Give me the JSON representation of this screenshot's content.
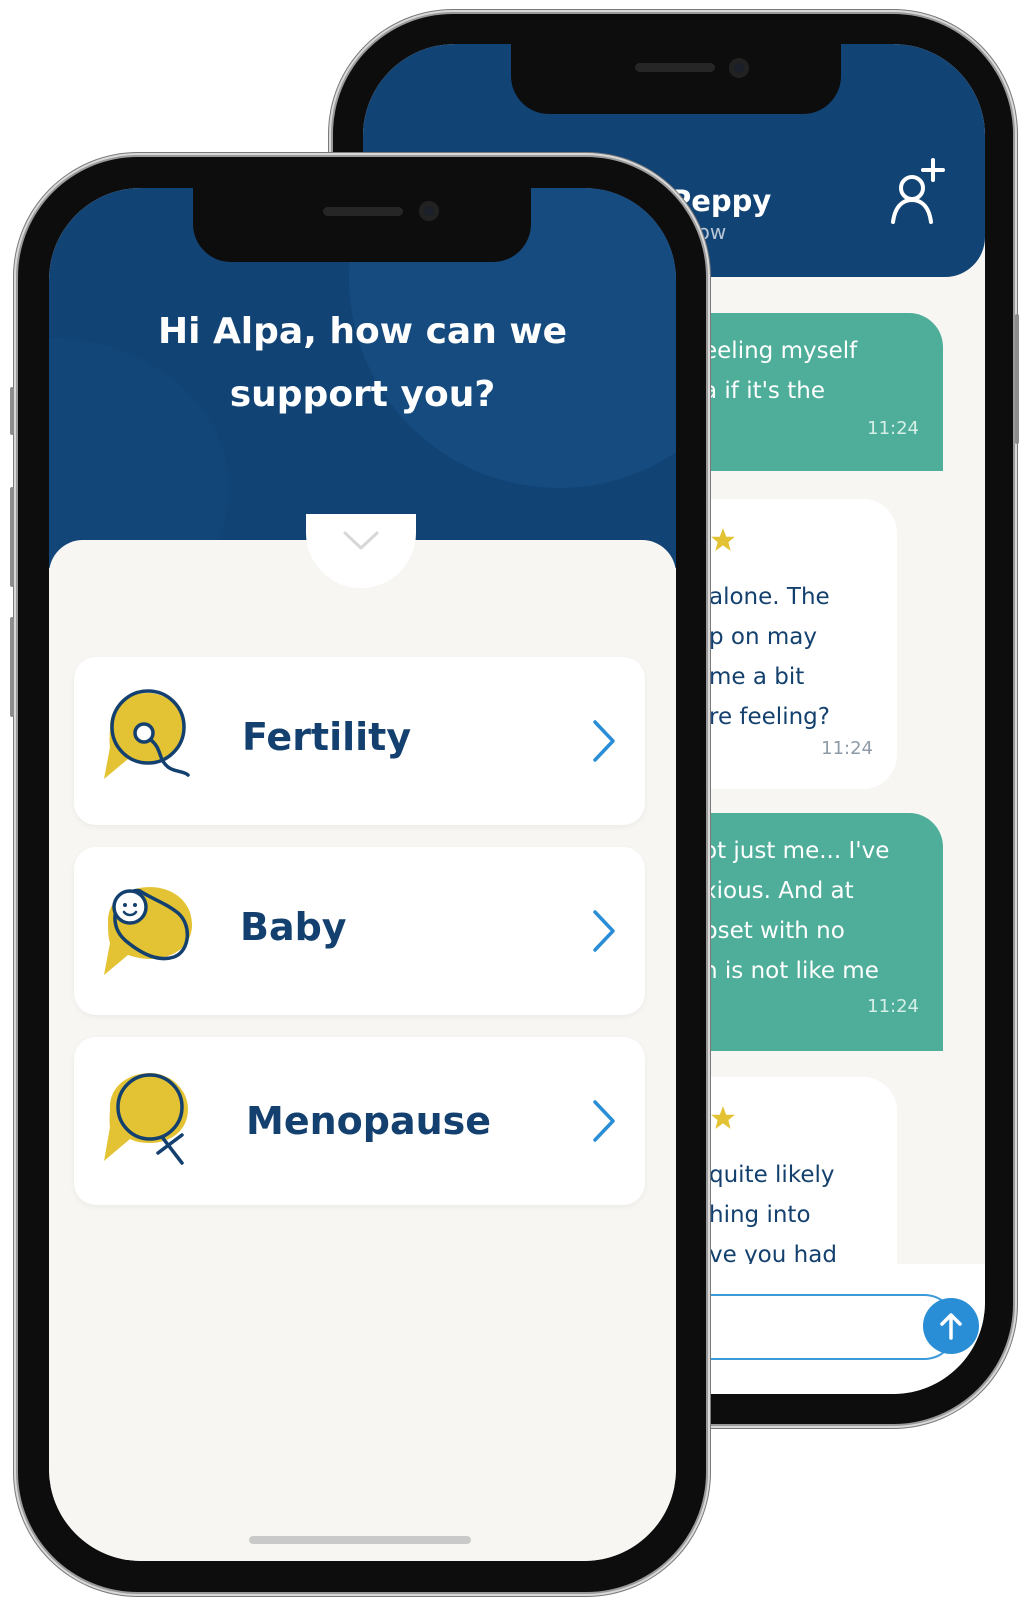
{
  "chat": {
    "contact_name": "ise Peppy",
    "status": "now",
    "messages": [
      {
        "direction": "out",
        "lines": [
          "eeling myself",
          "a if it's the"
        ],
        "time": "11:24"
      },
      {
        "direction": "in",
        "lines": [
          "alone. The",
          "p on may",
          "me a bit",
          "re feeling?"
        ],
        "time": "11:24"
      },
      {
        "direction": "out",
        "lines": [
          "ot just me... I've",
          "xious. And at",
          "pset with no",
          "n is not like me"
        ],
        "time": "11:24"
      },
      {
        "direction": "in",
        "lines": [
          "quite likely",
          "hing into",
          "ve you had"
        ],
        "time": ""
      }
    ]
  },
  "home": {
    "greeting_line1": "Hi Alpa, how can we",
    "greeting_line2": "support you?",
    "topics": [
      {
        "label": "Fertility",
        "icon": "fertility-icon"
      },
      {
        "label": "Baby",
        "icon": "baby-icon"
      },
      {
        "label": "Menopause",
        "icon": "menopause-icon"
      }
    ]
  },
  "colors": {
    "navy": "#114375",
    "teal": "#4fae99",
    "yellow": "#e3c333",
    "accent_blue": "#2a8ed6",
    "background": "#f8f6f2"
  }
}
